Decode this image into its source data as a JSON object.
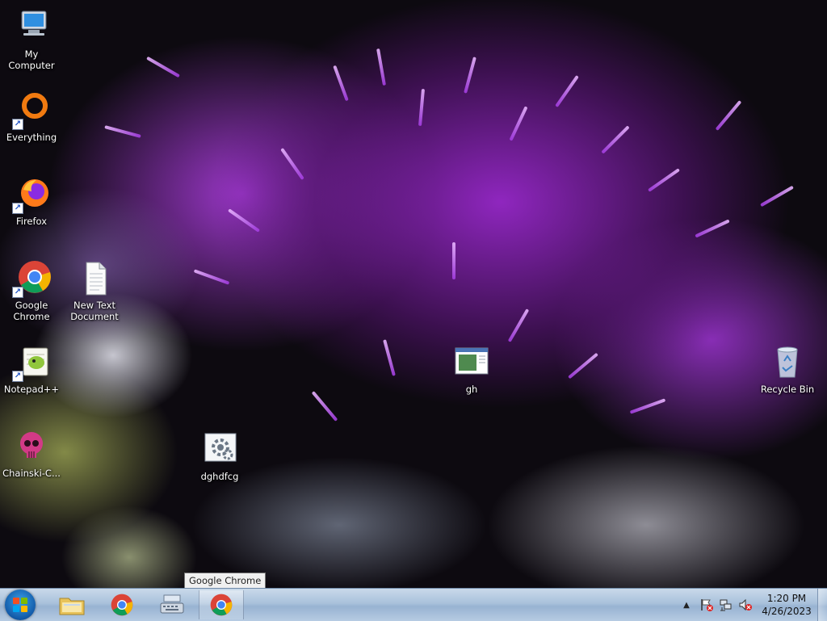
{
  "desktop": {
    "icons": [
      {
        "id": "my-computer",
        "label": "My Computer",
        "icon": "computer-icon"
      },
      {
        "id": "everything",
        "label": "Everything",
        "icon": "everything-icon"
      },
      {
        "id": "firefox",
        "label": "Firefox",
        "icon": "firefox-icon"
      },
      {
        "id": "google-chrome",
        "label": "Google Chrome",
        "icon": "chrome-icon"
      },
      {
        "id": "new-text-document",
        "label": "New Text Document",
        "icon": "text-document-icon"
      },
      {
        "id": "notepadpp",
        "label": "Notepad++",
        "icon": "notepadpp-icon"
      },
      {
        "id": "gh",
        "label": "gh",
        "icon": "window-app-icon"
      },
      {
        "id": "recycle-bin",
        "label": "Recycle Bin",
        "icon": "recycle-bin-icon"
      },
      {
        "id": "chainski",
        "label": "Chainski-C...",
        "icon": "skull-icon"
      },
      {
        "id": "dghdfcg",
        "label": "dghdfcg",
        "icon": "settings-app-icon"
      }
    ]
  },
  "tooltip": {
    "text": "Google Chrome"
  },
  "taskbar": {
    "pinned": [
      {
        "id": "explorer",
        "icon": "folder-icon"
      },
      {
        "id": "chrome-pinned",
        "icon": "chrome-icon"
      },
      {
        "id": "keyboard",
        "icon": "keyboard-icon"
      },
      {
        "id": "chrome-running",
        "icon": "chrome-icon"
      }
    ],
    "tray": {
      "icons": [
        "show-hidden-icons-icon",
        "action-center-flag-icon",
        "network-icon",
        "volume-muted-icon"
      ]
    },
    "clock": {
      "time": "1:20 PM",
      "date": "4/26/2023"
    }
  },
  "colors": {
    "taskbar": "#a9c1db",
    "tooltip_bg": "#f0f0f0",
    "chrome_red": "#db4437",
    "chrome_green": "#0f9d58",
    "chrome_yellow": "#f4b400",
    "chrome_blue": "#4285f4"
  }
}
